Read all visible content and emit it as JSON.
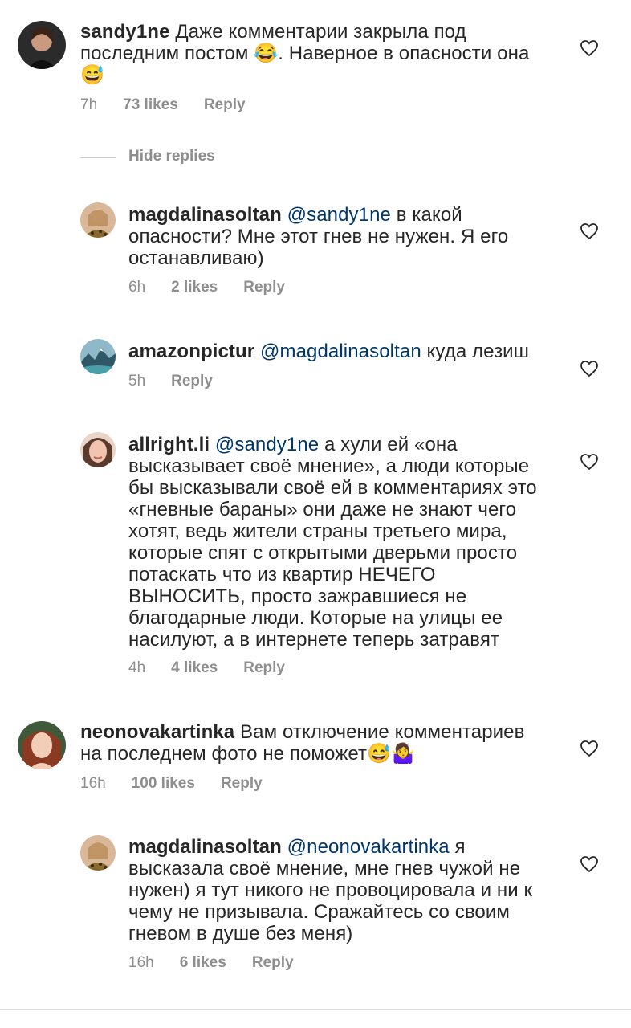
{
  "comments": [
    {
      "username": "sandy1ne",
      "mention": "",
      "text": "Даже комментарии закрыла под последним постом 😂. Наверное в опасности она 😅",
      "time": "7h",
      "likes": "73 likes",
      "reply": "Reply"
    },
    {
      "username": "magdalinasoltan",
      "mention": "@sandy1ne",
      "text": "в какой опасности? Мне этот гнев не нужен. Я его останавливаю)",
      "time": "6h",
      "likes": "2 likes",
      "reply": "Reply"
    },
    {
      "username": "amazonpictur",
      "mention": "@magdalinasoltan",
      "text": "куда лезиш",
      "time": "5h",
      "likes": "",
      "reply": "Reply"
    },
    {
      "username": "allright.li",
      "mention": "@sandy1ne",
      "text": "а хули ей «она высказывает своё мнение», а люди которые бы высказывали своё ей в комментариях это «гневные бараны» они даже не знают чего хотят, ведь жители страны третьего мира, которые спят с открытыми дверьми просто потаскать что из квартир НЕЧЕГО ВЫНОСИТЬ, просто зажравшиеся не благодарные люди. Которые на улицы ее насилуют, а в интернете теперь затравят",
      "time": "4h",
      "likes": "4 likes",
      "reply": "Reply"
    },
    {
      "username": "neonovakartinka",
      "mention": "",
      "text": "Вам отключение комментариев на последнем фото не поможет😅🤷‍♀️",
      "time": "16h",
      "likes": "100 likes",
      "reply": "Reply"
    },
    {
      "username": "magdalinasoltan",
      "mention": "@neonovakartinka",
      "text": "я высказала своё мнение, мне гнев чужой не нужен) я тут никого не провоцировала и ни к чему не призывала. Сражайтесь со своим гневом в душе без меня)",
      "time": "16h",
      "likes": "6 likes",
      "reply": "Reply"
    }
  ],
  "hide_replies": "Hide replies",
  "colors": {
    "text": "#262626",
    "muted": "#8e8e8e",
    "mention": "#00376b"
  },
  "icons": {
    "heart": "heart-outline-icon"
  }
}
